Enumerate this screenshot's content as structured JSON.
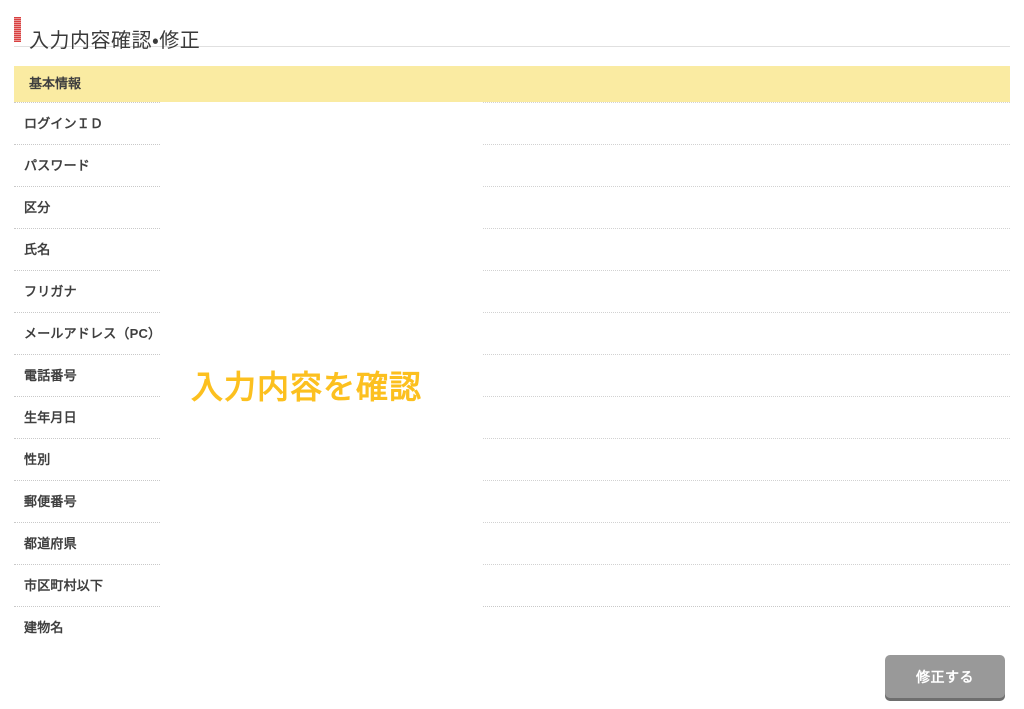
{
  "header": {
    "title": "入力内容確認・修正",
    "marker_color": "#d94040"
  },
  "section": {
    "label": "基本情報",
    "band_color": "#faeba2"
  },
  "fields": [
    {
      "label": "ログインＩＤ",
      "value": ""
    },
    {
      "label": "パスワード",
      "value": ""
    },
    {
      "label": "区分",
      "value": ""
    },
    {
      "label": "氏名",
      "value": ""
    },
    {
      "label": "フリガナ",
      "value": ""
    },
    {
      "label": "メールアドレス（PC）",
      "value": ""
    },
    {
      "label": "電話番号",
      "value": ""
    },
    {
      "label": "生年月日",
      "value": ""
    },
    {
      "label": "性別",
      "value": ""
    },
    {
      "label": "郵便番号",
      "value": ""
    },
    {
      "label": "都道府県",
      "value": ""
    },
    {
      "label": "市区町村以下",
      "value": ""
    },
    {
      "label": "建物名",
      "value": ""
    }
  ],
  "annotation": {
    "text": "入力内容を確認",
    "color": "#fcc01f"
  },
  "actions": {
    "edit_label": "修正する",
    "edit_color": "#999999"
  }
}
